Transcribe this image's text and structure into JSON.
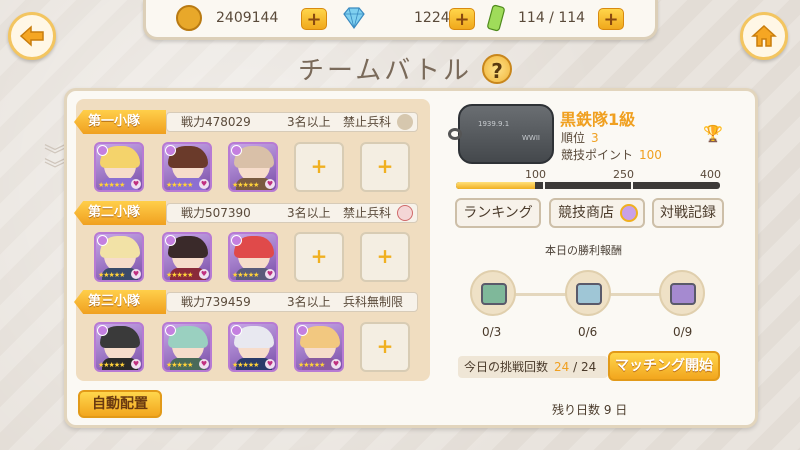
{
  "resources": {
    "coins": "2409144",
    "gems": "1224",
    "stamina": "114 / 114"
  },
  "title": "チームバトル",
  "help_label": "?",
  "squads": [
    {
      "label": "第一小隊",
      "power": "戦力478029",
      "requirement": "3名以上",
      "restriction": "禁止兵科",
      "members": [
        {
          "hair": "#f4d36b",
          "outfit": "#8c6fd1",
          "filled": true
        },
        {
          "hair": "#6a3a2a",
          "outfit": "#8c6fd1",
          "filled": true
        },
        {
          "hair": "#d9c0a8",
          "outfit": "#7a5a40",
          "filled": true
        },
        {
          "filled": false
        },
        {
          "filled": false
        }
      ]
    },
    {
      "label": "第二小隊",
      "power": "戦力507390",
      "requirement": "3名以上",
      "restriction": "禁止兵科",
      "members": [
        {
          "hair": "#f2e2a6",
          "outfit": "#3a4a6a",
          "filled": true
        },
        {
          "hair": "#3a2a2a",
          "outfit": "#8a2a3a",
          "filled": true
        },
        {
          "hair": "#e04a4a",
          "outfit": "#5a5a7a",
          "filled": true
        },
        {
          "filled": false
        },
        {
          "filled": false
        }
      ]
    },
    {
      "label": "第三小隊",
      "power": "戦力739459",
      "requirement": "3名以上",
      "restriction": "兵科無制限",
      "members": [
        {
          "hair": "#3a3a3a",
          "outfit": "#2a2a2a",
          "filled": true
        },
        {
          "hair": "#9ad0c0",
          "outfit": "#4a6a5a",
          "filled": true
        },
        {
          "hair": "#e8e8f0",
          "outfit": "#2a3a6a",
          "filled": true
        },
        {
          "hair": "#f2c880",
          "outfit": "#8a5aa0",
          "filled": true
        },
        {
          "filled": false
        }
      ]
    }
  ],
  "empty_slot_label": "+",
  "card_stars": "★★★★★",
  "auto_assign_label": "自動配置",
  "dogtag": {
    "line1": "1939.9.1",
    "line2": "WWII"
  },
  "rank": {
    "name": "黒鉄隊1級",
    "order_label": "順位",
    "order_value": "3",
    "points_label": "競技ポイント",
    "points_value": "100"
  },
  "progress": {
    "ticks": [
      "100",
      "250",
      "400"
    ],
    "fill_fraction": 0.3
  },
  "buttons": {
    "ranking": "ランキング",
    "shop": "競技商店",
    "record": "対戦記録"
  },
  "daily_rewards": {
    "title": "本日の勝利報酬",
    "chests": [
      {
        "count": "0/3",
        "color": "#7fb89a"
      },
      {
        "count": "0/6",
        "color": "#9fc6d6"
      },
      {
        "count": "0/9",
        "color": "#a58ad0"
      }
    ]
  },
  "challenge": {
    "label": "今日の挑戦回数",
    "current": "24",
    "separator": "/",
    "total": "24"
  },
  "match_label": "マッチング開始",
  "remaining_days": "残り日数 9 日"
}
